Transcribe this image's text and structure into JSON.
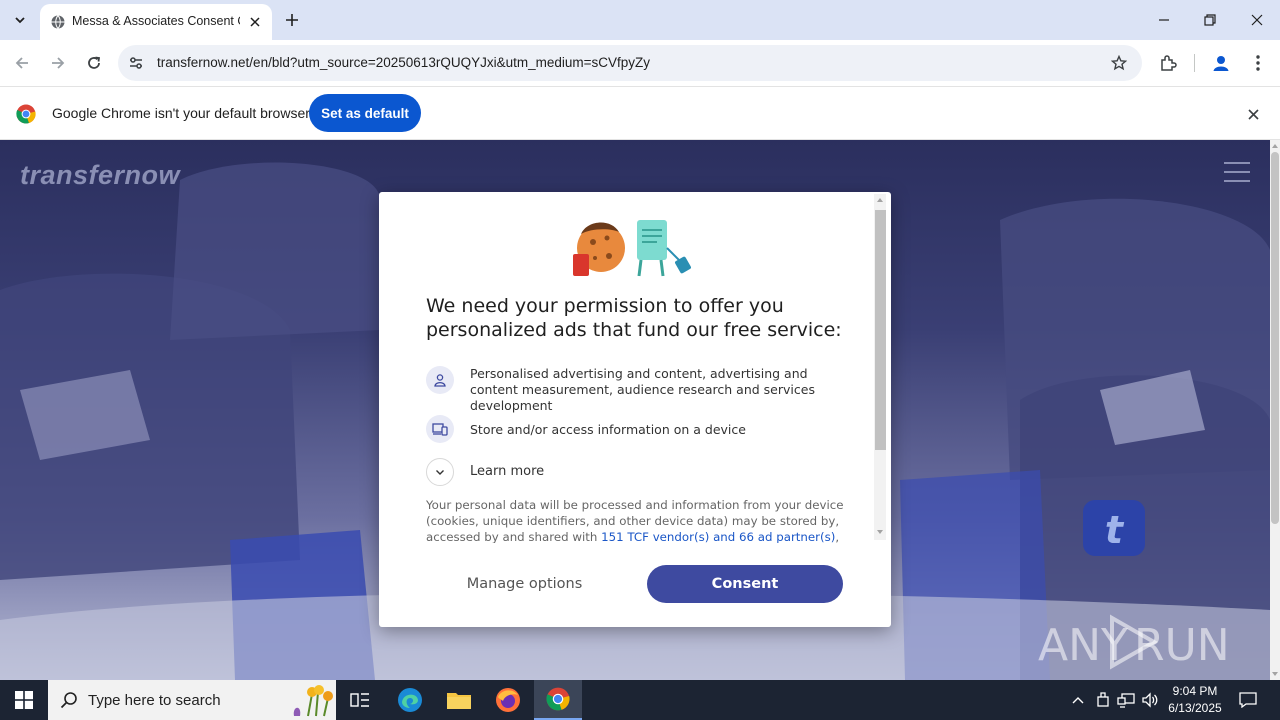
{
  "browser": {
    "tab": {
      "title": "Messa & Associates Consent Or"
    },
    "url": "transfernow.net/en/bld?utm_source=20250613rQUQYJxi&utm_medium=sCVfpyZy",
    "infobar": {
      "message": "Google Chrome isn't your default browser",
      "button_label": "Set as default"
    }
  },
  "page": {
    "logo_text": "transfernow"
  },
  "consent": {
    "heading": "We need your permission to offer you personalized ads that fund our free service:",
    "purposes": [
      {
        "icon": "person-icon",
        "text": "Personalised advertising and content, advertising and content measurement, audience research and services development"
      },
      {
        "icon": "devices-icon",
        "text": "Store and/or access information on a device"
      }
    ],
    "learn_more_label": "Learn more",
    "personal_data_text_1": "Your personal data will be processed and information from your device (cookies, unique identifiers, and other device data) may be stored by, accessed by and shared with ",
    "personal_data_link": "151 TCF vendor(s) and 66 ad partner(s)",
    "personal_data_text_2": ", or used specifically by this site or app.",
    "manage_options_label": "Manage options",
    "consent_label": "Consent"
  },
  "watermark": "ANY RUN",
  "taskbar": {
    "search_placeholder": "Type here to search",
    "time": "9:04 PM",
    "date": "6/13/2025"
  },
  "colors": {
    "accent": "#0b57d0",
    "consent_button": "#3e4aa0",
    "taskbar": "#1c2433"
  }
}
